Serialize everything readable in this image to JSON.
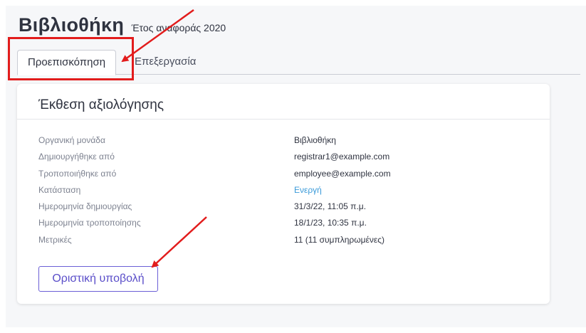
{
  "header": {
    "title": "Βιβλιοθήκη",
    "subtitle": "Έτος αναφοράς 2020"
  },
  "tabs": [
    {
      "label": "Προεπισκόπηση",
      "active": true
    },
    {
      "label": "Επεξεργασία",
      "active": false
    }
  ],
  "card": {
    "title": "Έκθεση αξιολόγησης",
    "rows": [
      {
        "label": "Οργανική μονάδα",
        "value": "Βιβλιοθήκη"
      },
      {
        "label": "Δημιουργήθηκε από",
        "value": "registrar1@example.com"
      },
      {
        "label": "Τροποποιήθηκε από",
        "value": "employee@example.com"
      },
      {
        "label": "Κατάσταση",
        "value": "Ενεργή"
      },
      {
        "label": "Ημερομηνία δημιουργίας",
        "value": "31/3/22, 11:05 π.μ."
      },
      {
        "label": "Ημερομηνία τροποποίησης",
        "value": "18/1/23, 10:35 π.μ."
      },
      {
        "label": "Μετρικές",
        "value": "11 (11 συμπληρωμένες)"
      }
    ],
    "submit_label": "Οριστική υποβολή"
  },
  "colors": {
    "annotation": "#e21c1c",
    "status_link": "#3a9ad9",
    "button_accent": "#5a4ec9"
  }
}
